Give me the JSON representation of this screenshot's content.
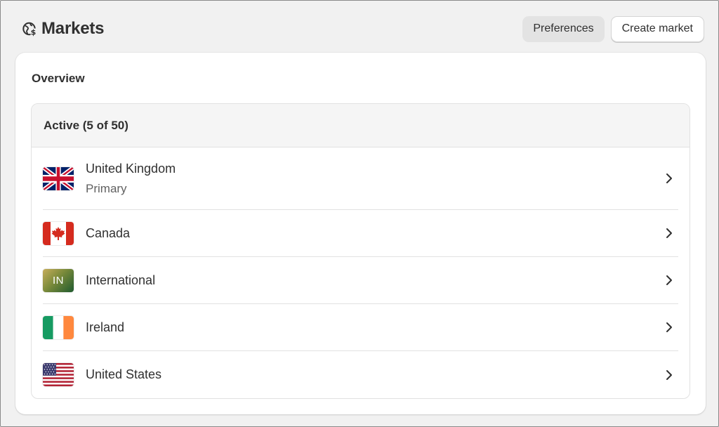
{
  "header": {
    "title": "Markets",
    "title_icon": "globe-icon",
    "preferences_label": "Preferences",
    "create_label": "Create market"
  },
  "card": {
    "title": "Overview",
    "section_title": "Active (5 of 50)",
    "markets": [
      {
        "name": "United Kingdom",
        "subtitle": "Primary",
        "flag": "flag-uk-icon"
      },
      {
        "name": "Canada",
        "flag": "flag-canada-icon"
      },
      {
        "name": "International",
        "badge": "IN",
        "flag": "international-badge-icon"
      },
      {
        "name": "Ireland",
        "flag": "flag-ireland-icon"
      },
      {
        "name": "United States",
        "flag": "flag-us-icon"
      }
    ]
  },
  "colors": {
    "background": "#f1f1f1",
    "card": "#ffffff",
    "text": "#303030",
    "muted_text": "#616161",
    "secondary_button": "#e3e3e3"
  }
}
